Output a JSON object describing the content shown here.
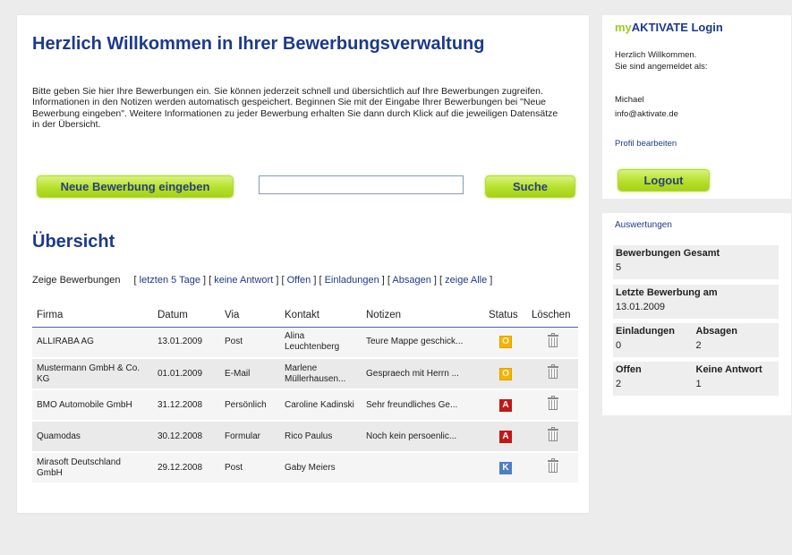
{
  "main": {
    "title": "Herzlich Willkommen in Ihrer Bewerbungsverwaltung",
    "intro": "Bitte geben Sie hier Ihre Bewerbungen ein. Sie können jederzeit schnell und übersichtlich auf Ihre Bewerbungen zugreifen. Informationen in den Notizen werden automatisch gespeichert. Beginnen Sie mit der Eingabe Ihrer Bewerbungen bei \"Neue Bewerbung eingeben\". Weitere Informationen zu jeder Bewerbung erhalten Sie dann durch Klick auf die jeweiligen Datensätze in der Übersicht.",
    "new_button": "Neue Bewerbung eingeben",
    "search_value": "",
    "search_button": "Suche",
    "overview_title": "Übersicht",
    "filter_lead": "Zeige Bewerbungen",
    "filters": [
      "letzten 5 Tage",
      "keine Antwort",
      "Offen",
      "Einladungen",
      "Absagen",
      "zeige Alle"
    ]
  },
  "table": {
    "headers": [
      "Firma",
      "Datum",
      "Via",
      "Kontakt",
      "Notizen",
      "Status",
      "Löschen"
    ],
    "rows": [
      {
        "firma": "ALLIRABA AG",
        "datum": "13.01.2009",
        "via": "Post",
        "kontakt": "Alina Leuchtenberg",
        "notizen": "Teure Mappe geschick...",
        "status": "O"
      },
      {
        "firma": "Mustermann GmbH & Co. KG",
        "datum": "01.01.2009",
        "via": "E-Mail",
        "kontakt": "Marlene Müllerhausen...",
        "notizen": "Gespraech mit Herrn ...",
        "status": "O"
      },
      {
        "firma": "BMO Automobile GmbH",
        "datum": "31.12.2008",
        "via": "Persönlich",
        "kontakt": "Caroline Kadinski",
        "notizen": "Sehr freundliches Ge...",
        "status": "A"
      },
      {
        "firma": "Quamodas",
        "datum": "30.12.2008",
        "via": "Formular",
        "kontakt": "Rico Paulus",
        "notizen": "Noch kein persoenlic...",
        "status": "A"
      },
      {
        "firma": "Mirasoft Deutschland GmbH",
        "datum": "29.12.2008",
        "via": "Post",
        "kontakt": "Gaby Meiers",
        "notizen": "",
        "status": "K"
      }
    ]
  },
  "login": {
    "title_prefix": "my",
    "title_rest": "AKTIVATE Login",
    "welcome": "Herzlich Willkommen.",
    "logged_in_as": "Sie sind angemeldet als:",
    "user_name": "Michael",
    "user_email": "info@aktivate.de",
    "profile_link": "Profil bearbeiten",
    "logout_button": "Logout"
  },
  "stats": {
    "title": "Auswertungen",
    "total_label": "Bewerbungen Gesamt",
    "total_value": "5",
    "last_label": "Letzte Bewerbung am",
    "last_value": "13.01.2009",
    "invites_label": "Einladungen",
    "invites_value": "0",
    "rejections_label": "Absagen",
    "rejections_value": "2",
    "open_label": "Offen",
    "open_value": "2",
    "noanswer_label": "Keine Antwort",
    "noanswer_value": "1"
  },
  "colors": {
    "heading_blue": "#1c3a8c",
    "button_green": "#b6e02d",
    "status_open": "#f4b400",
    "status_rejected": "#c01818",
    "status_contact": "#4d7fc4"
  }
}
